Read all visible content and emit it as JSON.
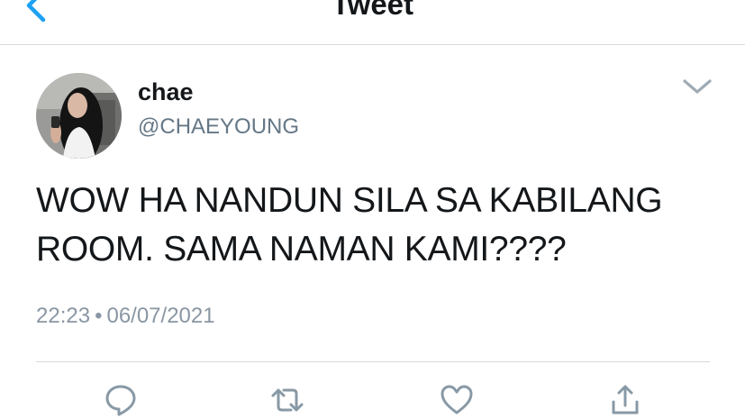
{
  "header": {
    "title": "Tweet",
    "back_icon": "chevron-left-icon"
  },
  "author": {
    "display_name": "chae",
    "handle": "@CHAEYOUNG",
    "avatar_icon": "avatar-photo"
  },
  "tweet": {
    "text_lines": [
      "WOW HA NANDUN SILA SA KABILANG",
      "ROOM. SAMA NAMAN KAMI????"
    ],
    "time": "22:23",
    "separator": "•",
    "date": "06/07/2021"
  },
  "actions": [
    {
      "name": "reply",
      "icon": "reply-icon"
    },
    {
      "name": "retweet",
      "icon": "retweet-icon"
    },
    {
      "name": "like",
      "icon": "heart-icon"
    },
    {
      "name": "share",
      "icon": "share-icon"
    }
  ],
  "colors": {
    "accent": "#1da1f2",
    "text": "#14171a",
    "secondary": "#657786",
    "icon": "#8899a6",
    "divider": "#d9d9d9"
  }
}
